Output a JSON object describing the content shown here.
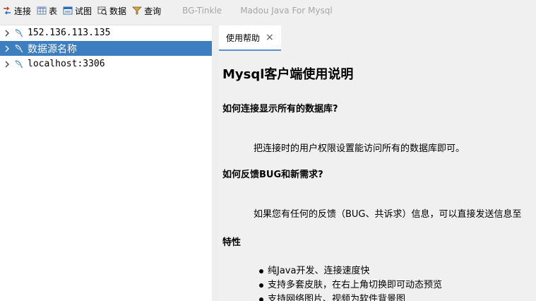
{
  "toolbar": {
    "items": [
      {
        "label": "连接",
        "icon": "connect-icon"
      },
      {
        "label": "表",
        "icon": "table-icon"
      },
      {
        "label": "试图",
        "icon": "view-icon"
      },
      {
        "label": "数据",
        "icon": "data-search-icon"
      },
      {
        "label": "查询",
        "icon": "query-filter-icon"
      }
    ],
    "themes": [
      "BG-Tinkle",
      "Madou Java For Mysql"
    ]
  },
  "tree": {
    "items": [
      {
        "label": "152.136.113.135",
        "selected": false
      },
      {
        "label": "数据源名称",
        "selected": true
      },
      {
        "label": "localhost:3306",
        "selected": false
      }
    ]
  },
  "tab": {
    "label": "使用帮助",
    "close": "×"
  },
  "doc": {
    "title": "Mysql客户端使用说明",
    "q1": "如何连接显示所有的数据库?",
    "a1": "把连接时的用户权限设置能访问所有的数据库即可。",
    "q2": "如何反馈BUG和新需求?",
    "a2": "如果您有任何的反馈（BUG、共诉求）信息，可以直接发送信息至",
    "features_title": "特性",
    "features": [
      "纯Java开发、连接速度快",
      "支持多套皮肤，在右上角切换即可动态预览",
      "支持网络图片、视频为软件背景图"
    ]
  },
  "colors": {
    "selection": "#3c7ebf",
    "tab_underline": "#5a8fd0",
    "theme_text": "#a6a6a6"
  }
}
